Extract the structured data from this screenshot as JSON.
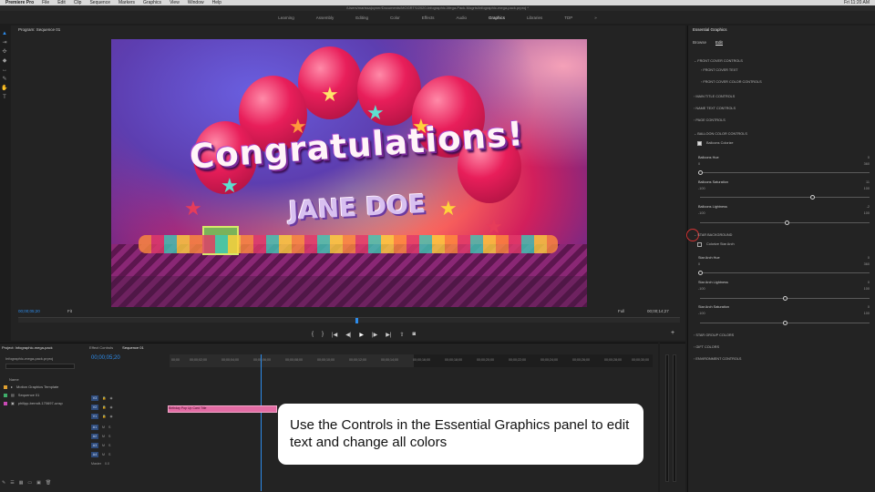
{
  "menubar": {
    "app": "Premiere Pro",
    "items": [
      "File",
      "Edit",
      "Clip",
      "Sequence",
      "Markers",
      "Graphics",
      "View",
      "Window",
      "Help"
    ],
    "clock": "Fri 11:20 AM"
  },
  "path": "/Users/marissajoyner/Documents/MOGRTS/2020-Infographic-Mega-Pack-Mogrts/Infographic-mega-pack.prproj *",
  "workspaces": {
    "items": [
      "Learning",
      "Assembly",
      "Editing",
      "Color",
      "Effects",
      "Audio",
      "Graphics",
      "Libraries",
      "TDP"
    ],
    "active": "Graphics"
  },
  "program": {
    "title": "Program: Sequence 01",
    "timecode": "00;00;05;20",
    "fit": "Fit",
    "resolution": "Full",
    "duration": "00;00;14;27",
    "video_text_1": "Congratulations!",
    "video_text_2": "JANE DOE"
  },
  "essential_graphics": {
    "title": "Essential Graphics",
    "tabs": [
      "Browse",
      "Edit"
    ],
    "active_tab": "Edit",
    "front_cover_controls": "FRONT COVER CONTROLS",
    "front_cover_text": "FRONT COVER TEXT",
    "front_cover_color_controls": "FRONT COVER COLOR CONTROLS",
    "main_title_controls": "MAIN TITLE CONTROLS",
    "name_text_controls": "NAME TEXT CONTROLS",
    "page_controls": "PAGE CONTROLS",
    "balloon_color_controls": "BALLOON COLOR CONTROLS",
    "balloons_colorize": "Balloons Colorize",
    "balloons_hue": {
      "label": "Balloons Hue",
      "min": "0",
      "max": "360",
      "value": "0",
      "level": 0.0
    },
    "balloons_saturation": {
      "label": "Balloons Saturation",
      "min": "-100",
      "max": "100",
      "value": "11",
      "level": 0.66
    },
    "balloons_lightness": {
      "label": "Balloons Lightness",
      "min": "-100",
      "max": "100",
      "value": "-2",
      "level": 0.51
    },
    "star_background": "STAR BACKGROUND",
    "colorize_star_arch": "Colorize Star Arch",
    "star_arch_hue": {
      "label": "Star Arch Hue",
      "min": "0",
      "max": "360",
      "value": "0",
      "level": 0.0
    },
    "star_arch_lightness": {
      "label": "Star Arch Lightness",
      "min": "-100",
      "max": "100",
      "value": "0",
      "level": 0.5
    },
    "star_arch_saturation": {
      "label": "Star Arch Saturation",
      "min": "-100",
      "max": "100",
      "value": "0",
      "level": 0.5
    },
    "star_group_colors": "STAR GROUP COLORS",
    "gift_colors": "GIFT COLORS",
    "environment_controls": "ENVIRONMENT CONTROLS"
  },
  "project": {
    "tab": "Project: Infographic-mega-pack",
    "file": "Infographic-mega-pack.prproj",
    "name_header": "Name",
    "items": [
      {
        "label": "Motion Graphics Template",
        "color": "#e0a030"
      },
      {
        "label": "Sequence 01",
        "color": "#3fae6a"
      },
      {
        "label": "philipp-berndt-170697-unsp",
        "color": "#c94ab5"
      }
    ]
  },
  "timeline": {
    "tabs": [
      "Effect Controls",
      "Sequence 01"
    ],
    "active_tab": "Sequence 01",
    "timecode": "00;00;05;20",
    "ruler": [
      "00;00",
      "00;00;02;00",
      "00;00;04;00",
      "00;00;06;00",
      "00;00;08;00",
      "00;00;10;00",
      "00;00;12;00",
      "00;00;14;00",
      "00;00;16;00",
      "00;00;18;00",
      "00;00;20;00",
      "00;00;22;00",
      "00;00;24;00",
      "00;00;26;00",
      "00;00;28;00",
      "00;00;30;00"
    ],
    "video_tracks": [
      "V3",
      "V2",
      "V1"
    ],
    "audio_tracks": [
      "A1",
      "A2",
      "A3",
      "A4"
    ],
    "master_label": "Master",
    "master_value": "0.0",
    "clip_label": "Birthday Pop Up Card Title"
  },
  "caption": "Use the Controls in the Essential Graphics panel to edit text and change all colors"
}
